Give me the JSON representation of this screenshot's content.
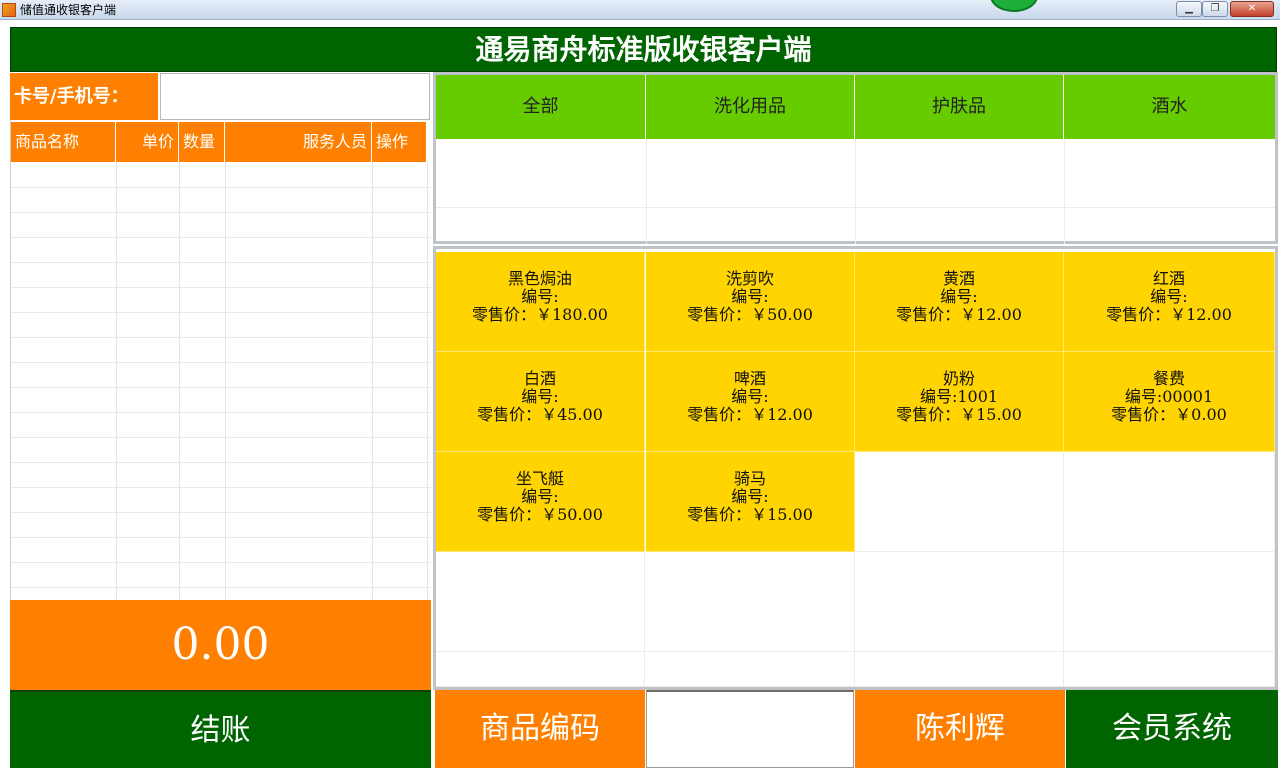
{
  "window": {
    "title": "储值通收银客户端",
    "buttons": {
      "minimize": "▁",
      "maximize": "❐",
      "close": "✕"
    }
  },
  "header": {
    "title": "通易商舟标准版收银客户端"
  },
  "card": {
    "label": "卡号/手机号：",
    "value": ""
  },
  "cart": {
    "columns": [
      "商品名称",
      "单价",
      "数量",
      "服务人员",
      "操作"
    ]
  },
  "total": {
    "amount": "0.00"
  },
  "checkout": {
    "label": "结账"
  },
  "categories": [
    {
      "label": "全部"
    },
    {
      "label": "洗化用品"
    },
    {
      "label": "护肤品"
    },
    {
      "label": "酒水"
    }
  ],
  "products": [
    {
      "name": "黑色焗油",
      "code": "编号:",
      "price": "零售价：￥180.00"
    },
    {
      "name": "洗剪吹",
      "code": "编号:",
      "price": "零售价：￥50.00"
    },
    {
      "name": "黄酒",
      "code": "编号:",
      "price": "零售价：￥12.00"
    },
    {
      "name": "红酒",
      "code": "编号:",
      "price": "零售价：￥12.00"
    },
    {
      "name": "白酒",
      "code": "编号:",
      "price": "零售价：￥45.00"
    },
    {
      "name": "啤酒",
      "code": "编号:",
      "price": "零售价：￥12.00"
    },
    {
      "name": "奶粉",
      "code": "编号:1001",
      "price": "零售价：￥15.00"
    },
    {
      "name": "餐费",
      "code": "编号:00001",
      "price": "零售价：￥0.00"
    },
    {
      "name": "坐飞艇",
      "code": "编号:",
      "price": "零售价：￥50.00"
    },
    {
      "name": "骑马",
      "code": "编号:",
      "price": "零售价：￥15.00"
    }
  ],
  "bottom": {
    "code_label": "商品编码",
    "code_value": "",
    "staff": "陈利辉",
    "member": "会员系统"
  },
  "colors": {
    "header_green": "#006400",
    "orange": "#ff8000",
    "category_green": "#66cc00",
    "product_yellow": "#ffd400"
  }
}
